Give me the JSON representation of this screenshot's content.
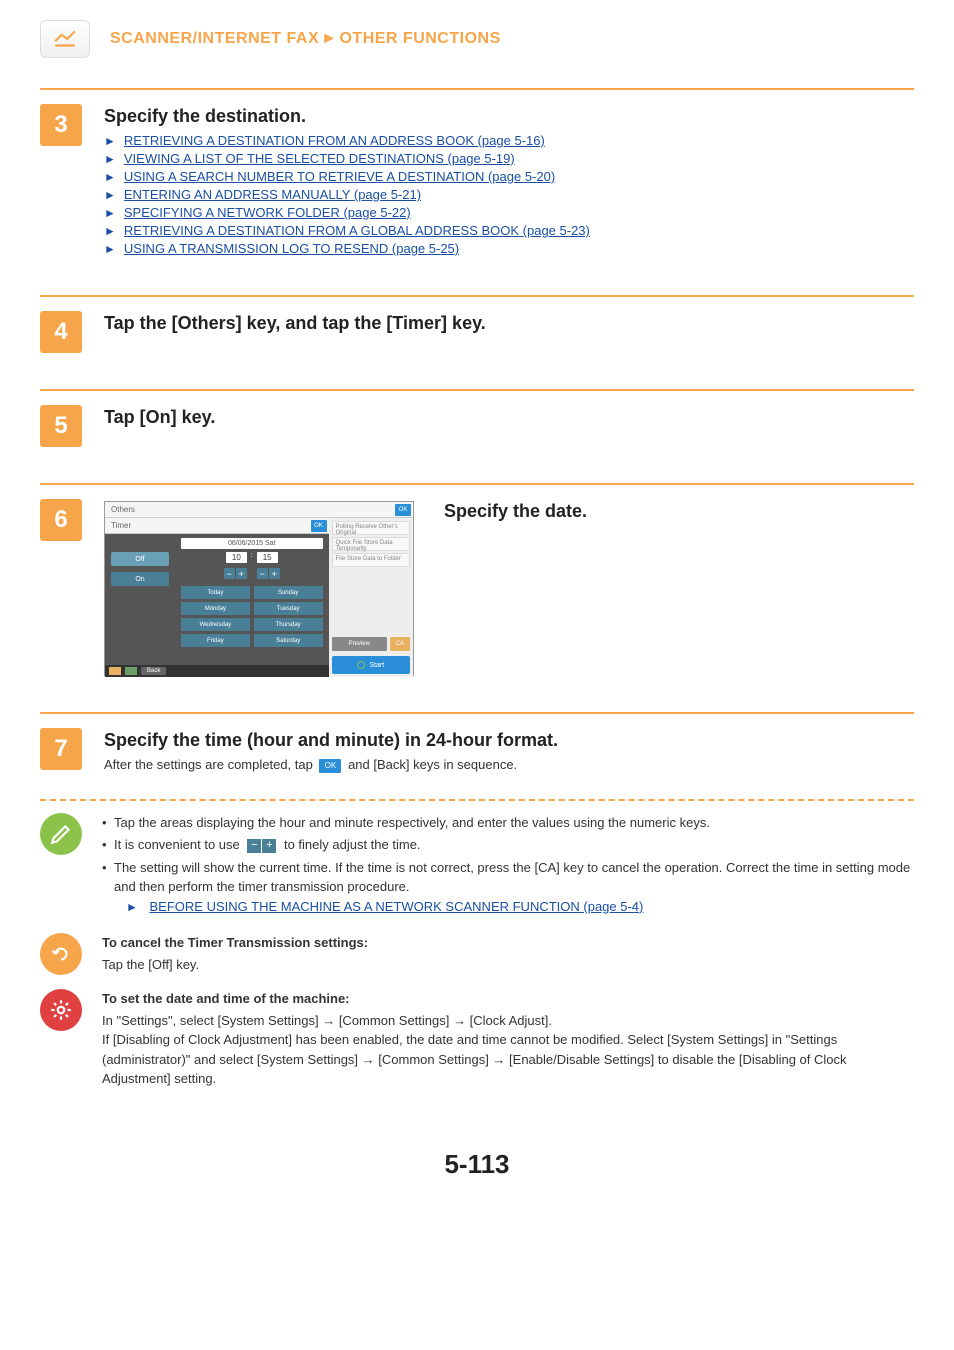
{
  "header": {
    "category": "SCANNER/INTERNET FAX",
    "separator": "►",
    "section": "OTHER FUNCTIONS"
  },
  "steps": {
    "3": {
      "number": "3",
      "title": "Specify the destination.",
      "links": [
        "RETRIEVING A DESTINATION FROM AN ADDRESS BOOK (page 5-16)",
        "VIEWING A LIST OF THE SELECTED DESTINATIONS (page 5-19)",
        "USING A SEARCH NUMBER TO RETRIEVE A DESTINATION (page 5-20)",
        "ENTERING AN ADDRESS MANUALLY (page 5-21)",
        "SPECIFYING A NETWORK FOLDER (page 5-22)",
        "RETRIEVING A DESTINATION FROM A GLOBAL ADDRESS BOOK (page 5-23)",
        "USING A TRANSMISSION LOG TO RESEND (page 5-25)"
      ]
    },
    "4": {
      "number": "4",
      "title": "Tap the [Others] key, and tap the [Timer] key."
    },
    "5": {
      "number": "5",
      "title": "Tap [On] key."
    },
    "6": {
      "number": "6",
      "title": "Specify the date."
    },
    "7": {
      "number": "7",
      "title": "Specify the time (hour and minute) in 24-hour format.",
      "sub_pre": "After the settings are completed, tap ",
      "sub_post": " and [Back] keys in sequence."
    }
  },
  "screenshot": {
    "others": "Others",
    "timer": "Timer",
    "ok": "OK",
    "off": "Off",
    "on": "On",
    "date": "06/06/2015 Sat",
    "hour": "10",
    "minute": "15",
    "days": [
      "Today",
      "Sunday",
      "Monday",
      "Tuesday",
      "Wednesday",
      "Thursday",
      "Friday",
      "Saturday"
    ],
    "back": "Back",
    "right_items": [
      "Polling\nReceive Other's Original",
      "Quick File\nStore Data Temporarily",
      "File\nStore Data to Folder"
    ],
    "preview": "Preview",
    "ca": "CA",
    "start": "Start"
  },
  "notes": {
    "green": {
      "item1": "Tap the areas displaying the hour and minute respectively, and enter the values using the numeric keys.",
      "item2_pre": "It is convenient to use ",
      "item2_post": " to finely adjust the time.",
      "item3": "The setting will show the current time. If the time is not correct, press the [CA] key to cancel the operation. Correct the time in setting mode and then perform the timer transmission procedure.",
      "item3_link": "BEFORE USING THE MACHINE AS A NETWORK SCANNER FUNCTION (page 5-4)"
    },
    "orange": {
      "title": "To cancel the Timer Transmission settings:",
      "body": "Tap the [Off] key."
    },
    "red": {
      "title": "To set the date and time of the machine:",
      "body": "In \"Settings\", select [System Settings] → [Common Settings] → [Clock Adjust].\nIf [Disabling of Clock Adjustment] has been enabled, the date and time cannot be modified. Select [System Settings] in \"Settings (administrator)\" and select [System Settings] → [Common Settings] → [Enable/Disable Settings] to disable the [Disabling of Clock Adjustment] setting."
    }
  },
  "arrow": "►",
  "ok_label": "OK",
  "page_number": "5-113"
}
